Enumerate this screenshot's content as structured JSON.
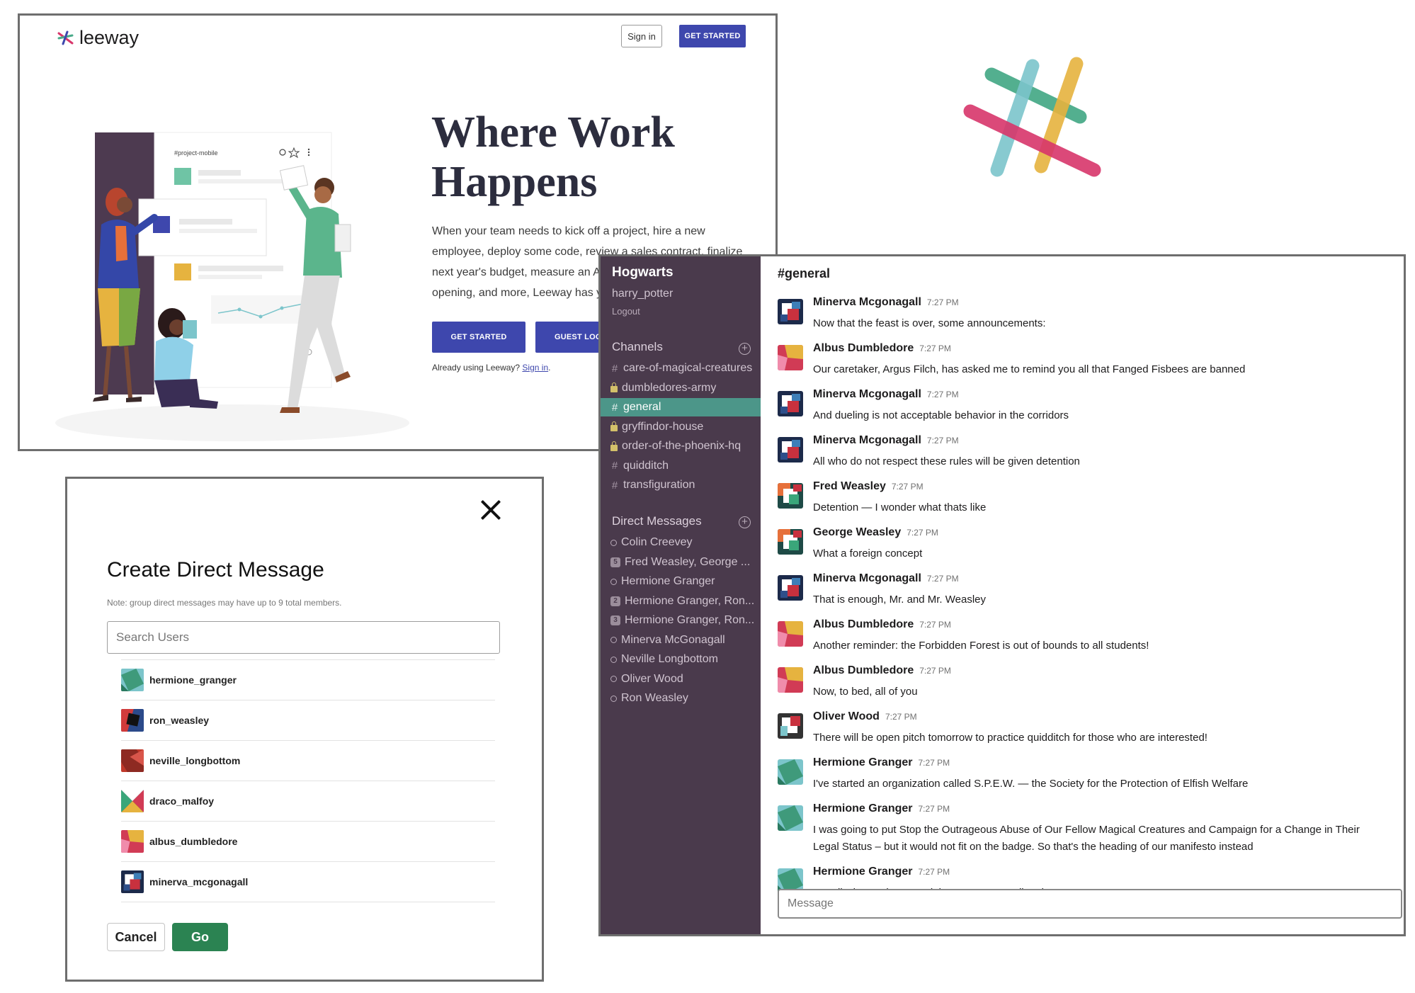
{
  "landing": {
    "brand": "leeway",
    "sign_in": "Sign in",
    "get_started": "GET STARTED",
    "hero_title": "Where Work Happens",
    "hero_desc": "When your team needs to kick off a project, hire a new employee, deploy some code, review a sales contract, finalize next year's budget, measure an A/B test, plan your next office opening, and more, Leeway has you covered.",
    "cta_primary": "GET STARTED",
    "cta_guest": "GUEST LOGIN",
    "already_text": "Already using Leeway?",
    "already_link": "Sign in",
    "illustration": {
      "channel": "#project-mobile"
    }
  },
  "slack": {
    "workspace": "Hogwarts",
    "username": "harry_potter",
    "logout": "Logout",
    "channels_header": "Channels",
    "channels": [
      {
        "name": "care-of-magical-creatures",
        "type": "public",
        "active": false
      },
      {
        "name": "dumbledores-army",
        "type": "private",
        "active": false
      },
      {
        "name": "general",
        "type": "public",
        "active": true
      },
      {
        "name": "gryffindor-house",
        "type": "private",
        "active": false
      },
      {
        "name": "order-of-the-phoenix-hq",
        "type": "private",
        "active": false
      },
      {
        "name": "quidditch",
        "type": "public",
        "active": false
      },
      {
        "name": "transfiguration",
        "type": "public",
        "active": false
      }
    ],
    "dm_header": "Direct Messages",
    "dms": [
      {
        "name": "Colin Creevey",
        "badge": ""
      },
      {
        "name": "Fred Weasley, George ...",
        "badge": "5"
      },
      {
        "name": "Hermione Granger",
        "badge": ""
      },
      {
        "name": "Hermione Granger, Ron...",
        "badge": "2"
      },
      {
        "name": "Hermione Granger, Ron...",
        "badge": "3"
      },
      {
        "name": "Minerva McGonagall",
        "badge": ""
      },
      {
        "name": "Neville Longbottom",
        "badge": ""
      },
      {
        "name": "Oliver Wood",
        "badge": ""
      },
      {
        "name": "Ron Weasley",
        "badge": ""
      }
    ],
    "channel_title": "#general",
    "messages": [
      {
        "author": "Minerva Mcgonagall",
        "time": "7:27 PM",
        "text": "Now that the feast is over, some announcements:",
        "avatar": "minerva"
      },
      {
        "author": "Albus Dumbledore",
        "time": "7:27 PM",
        "text": "Our caretaker, Argus Filch, has asked me to remind you all that Fanged Fisbees are banned",
        "avatar": "albus"
      },
      {
        "author": "Minerva Mcgonagall",
        "time": "7:27 PM",
        "text": "And dueling is not acceptable behavior in the corridors",
        "avatar": "minerva"
      },
      {
        "author": "Minerva Mcgonagall",
        "time": "7:27 PM",
        "text": "All who do not respect these rules will be given detention",
        "avatar": "minerva"
      },
      {
        "author": "Fred Weasley",
        "time": "7:27 PM",
        "text": "Detention — I wonder what thats like",
        "avatar": "fred"
      },
      {
        "author": "George Weasley",
        "time": "7:27 PM",
        "text": "What a foreign concept",
        "avatar": "fred"
      },
      {
        "author": "Minerva Mcgonagall",
        "time": "7:27 PM",
        "text": "That is enough, Mr. and Mr. Weasley",
        "avatar": "minerva"
      },
      {
        "author": "Albus Dumbledore",
        "time": "7:27 PM",
        "text": "Another reminder: the Forbidden Forest is out of bounds to all students!",
        "avatar": "albus"
      },
      {
        "author": "Albus Dumbledore",
        "time": "7:27 PM",
        "text": "Now, to bed, all of you",
        "avatar": "albus"
      },
      {
        "author": "Oliver Wood",
        "time": "7:27 PM",
        "text": "There will be open pitch tomorrow to practice quidditch for those who are interested!",
        "avatar": "oliver"
      },
      {
        "author": "Hermione Granger",
        "time": "7:27 PM",
        "text": "I've started an organization called S.P.E.W. — the Society for the Protection of Elfish Welfare",
        "avatar": "hermione"
      },
      {
        "author": "Hermione Granger",
        "time": "7:27 PM",
        "text": "I was going to put Stop the Outrageous Abuse of Our Fellow Magical Creatures and Campaign for a Change in Their Legal Status – but it would not fit on the badge. So that's the heading of our manifesto instead",
        "avatar": "hermione"
      },
      {
        "author": "Hermione Granger",
        "time": "7:27 PM",
        "text": "For all who are interested, just Leeway me directly!",
        "avatar": "hermione"
      }
    ],
    "message_placeholder": "Message"
  },
  "modal": {
    "title": "Create Direct Message",
    "note": "Note: group direct messages may have up to 9 total members.",
    "search_placeholder": "Search Users",
    "users": [
      {
        "name": "hermione_granger",
        "avatar": "hermione"
      },
      {
        "name": "ron_weasley",
        "avatar": "ron"
      },
      {
        "name": "neville_longbottom",
        "avatar": "neville"
      },
      {
        "name": "draco_malfoy",
        "avatar": "draco"
      },
      {
        "name": "albus_dumbledore",
        "avatar": "albus"
      },
      {
        "name": "minerva_mcgonagall",
        "avatar": "minerva"
      }
    ],
    "cancel": "Cancel",
    "go": "Go"
  },
  "colors": {
    "primary_blue": "#3e47ad",
    "sidebar_bg": "#4a3a4c",
    "active_channel": "#4c9689",
    "go_green": "#2b8352",
    "logo_green": "#4aab8a",
    "logo_teal": "#7cc5cb",
    "logo_yellow": "#e6b33f",
    "logo_pink": "#d8366b"
  }
}
